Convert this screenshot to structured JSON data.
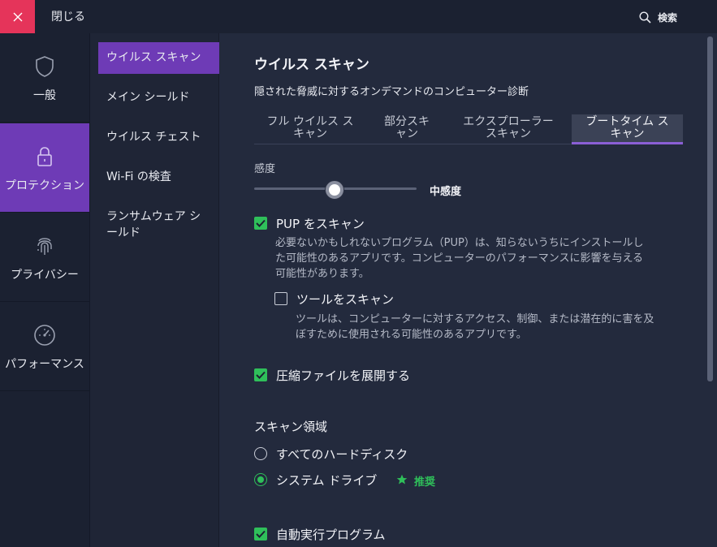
{
  "titlebar": {
    "close_label": "閉じる",
    "search_label": "検索"
  },
  "categories": [
    {
      "label": "一般",
      "icon": "shield-icon"
    },
    {
      "label": "プロテクション",
      "icon": "lock-icon"
    },
    {
      "label": "プライバシー",
      "icon": "fingerprint-icon"
    },
    {
      "label": "パフォーマンス",
      "icon": "speedometer-icon"
    }
  ],
  "subnav": [
    "ウイルス スキャン",
    "メイン シールド",
    "ウイルス チェスト",
    "Wi-Fi の検査",
    "ランサムウェア シールド"
  ],
  "main": {
    "title": "ウイルス スキャン",
    "subtitle": "隠された脅威に対するオンデマンドのコンピューター診断",
    "tabs": [
      {
        "line1": "フル ウイルス ス",
        "line2": "キャン"
      },
      {
        "line1": "部分スキ",
        "line2": "ャン"
      },
      {
        "line1": "エクスプローラー",
        "line2": "スキャン"
      },
      {
        "line1": "ブートタイム ス",
        "line2": "キャン"
      }
    ],
    "sensitivity_label": "感度",
    "sensitivity_value": "中感度",
    "sensitivity_level": 0.5,
    "pup": {
      "label": "PUP をスキャン",
      "checked": true,
      "desc1": "必要ないかもしれないプログラム（PUP）は、知らないうちにインストールし",
      "desc2": "た可能性のあるアプリです。コンピューターのパフォーマンスに影響を与える",
      "desc3": "可能性があります。"
    },
    "tools": {
      "label": "ツールをスキャン",
      "checked": false,
      "desc1": "ツールは、コンピューターに対するアクセス、制御、または潜在的に害を及",
      "desc2": "ぼすために使用される可能性のあるアプリです。"
    },
    "archive": {
      "label": "圧縮ファイルを展開する",
      "checked": true
    },
    "scan_area": {
      "title": "スキャン領域",
      "options": [
        {
          "label": "すべてのハードディスク",
          "selected": false
        },
        {
          "label": "システム ドライブ",
          "selected": true
        }
      ],
      "recommended": "推奨"
    },
    "autorun": {
      "label": "自動実行プログラム",
      "checked": true
    }
  },
  "colors": {
    "accent": "#6e3bb6",
    "check": "#2fbf5a",
    "close": "#e5345a"
  }
}
